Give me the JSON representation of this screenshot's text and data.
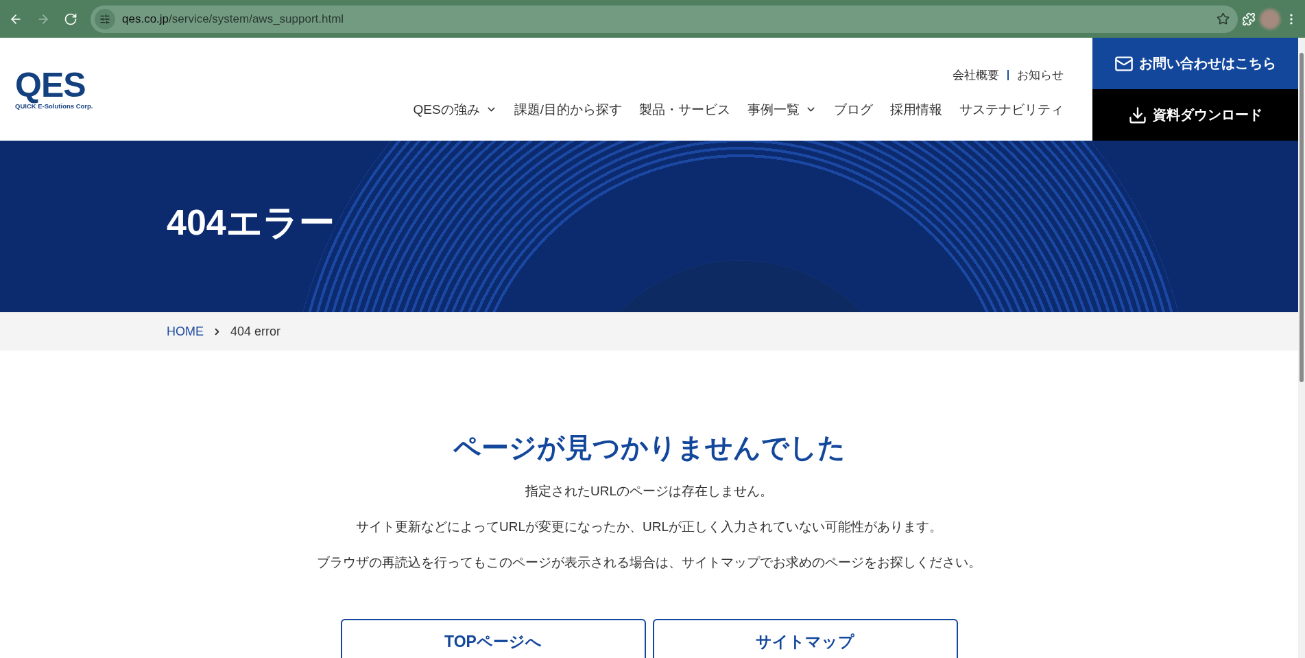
{
  "browser": {
    "nav_buttons": [
      {
        "kind": "back",
        "disabled": false
      },
      {
        "kind": "forward",
        "disabled": true
      },
      {
        "kind": "reload",
        "disabled": false
      }
    ],
    "url_host": "qes.co.jp",
    "url_path": "/service/system/aws_support.html"
  },
  "header": {
    "logo": {
      "mark": "QES",
      "tagline": "QUICK E-Solutions Corp."
    },
    "utility_links": [
      "会社概要",
      "お知らせ"
    ],
    "nav": [
      {
        "label": "QESの強み",
        "dropdown": true
      },
      {
        "label": "課題/目的から探す",
        "dropdown": false
      },
      {
        "label": "製品・サービス",
        "dropdown": false
      },
      {
        "label": "事例一覧",
        "dropdown": true
      },
      {
        "label": "ブログ",
        "dropdown": false
      },
      {
        "label": "採用情報",
        "dropdown": false
      },
      {
        "label": "サステナビリティ",
        "dropdown": false
      }
    ],
    "contact_button": "お問い合わせはこちら",
    "download_button": "資料ダウンロード"
  },
  "hero": {
    "title": "404エラー"
  },
  "breadcrumb": [
    {
      "label": "HOME",
      "link": true
    },
    {
      "label": "404 error",
      "link": false
    }
  ],
  "content": {
    "heading": "ページが見つかりませんでした",
    "paragraphs": [
      "指定されたURLのページは存在しません。",
      "サイト更新などによってURLが変更になったか、URLが正しく入力されていない可能性があります。",
      "ブラウザの再読込を行ってもこのページが表示される場合は、サイトマップでお求めのページをお探しください。"
    ],
    "buttons": [
      "TOPページへ",
      "サイトマップ"
    ]
  }
}
